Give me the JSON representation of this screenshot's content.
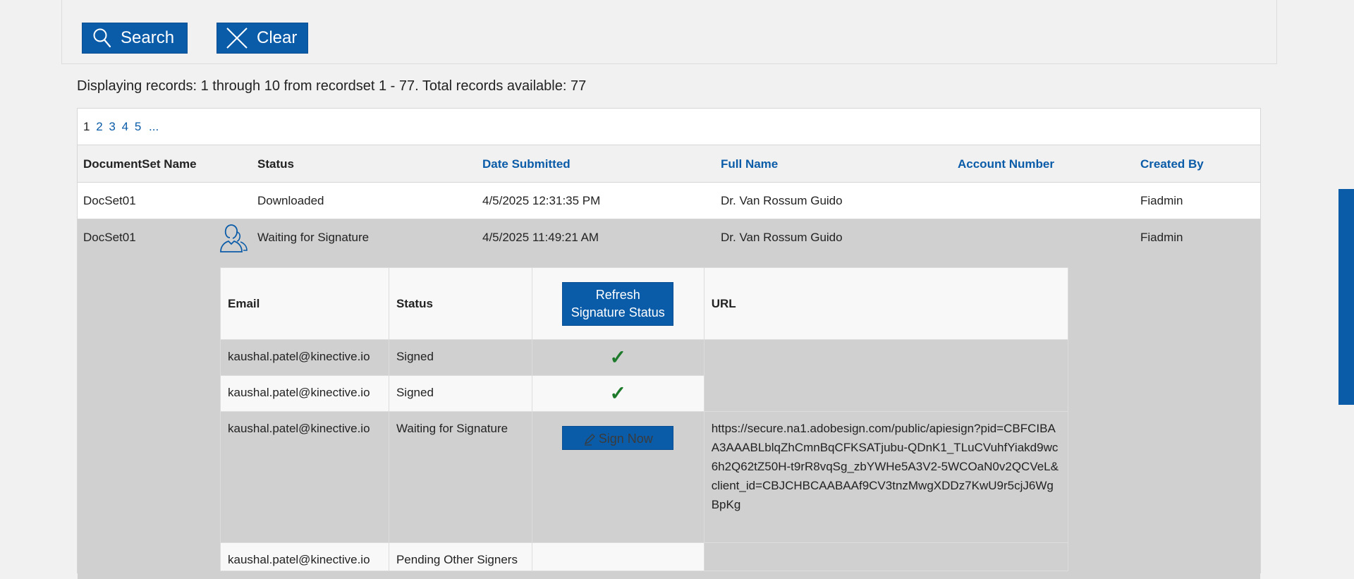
{
  "search": {
    "search_label": "Search",
    "clear_label": "Clear"
  },
  "records_info": "Displaying records: 1 through 10 from recordset 1 - 77. Total records available: 77",
  "pager": {
    "current": "1",
    "pages": [
      "2",
      "3",
      "4",
      "5"
    ],
    "more": "..."
  },
  "columns": {
    "name": "DocumentSet Name",
    "status": "Status",
    "date": "Date Submitted",
    "full_name": "Full Name",
    "account": "Account Number",
    "created_by": "Created By"
  },
  "rows": [
    {
      "name": "DocSet01",
      "status": "Downloaded",
      "date": "4/5/2025 12:31:35 PM",
      "full_name": "Dr. Van Rossum Guido",
      "account": "",
      "created_by": "Fiadmin"
    },
    {
      "name": "DocSet01",
      "status": "Waiting for Signature",
      "date": "4/5/2025 11:49:21 AM",
      "full_name": "Dr. Van Rossum Guido",
      "account": "",
      "created_by": "Fiadmin"
    }
  ],
  "signers": {
    "headers": {
      "email": "Email",
      "status": "Status",
      "refresh_line1": "Refresh",
      "refresh_line2": "Signature Status",
      "url": "URL"
    },
    "rows": [
      {
        "email": "kaushal.patel@kinective.io",
        "status": "Signed",
        "check": "✓"
      },
      {
        "email": "kaushal.patel@kinective.io",
        "status": "Signed",
        "check": "✓"
      },
      {
        "email": "kaushal.patel@kinective.io",
        "status": "Waiting for Signature",
        "action": "Sign Now",
        "url": "https://secure.na1.adobesign.com/public/apiesign?pid=CBFCIBAA3AAABLblqZhCmnBqCFKSATjubu-QDnK1_TLuCVuhfYiakd9wc6h2Q62tZ50H-t9rR8vqSg_zbYWHe5A3V2-5WCOaN0v2QCVeL&client_id=CBJCHBCAABAAf9CV3tnzMwgXDDz7KwU9r5cjJ6WgBpKg"
      },
      {
        "email": "kaushal.patel@kinective.io",
        "status": "Pending Other Signers"
      }
    ]
  },
  "colors": {
    "accent": "#0b5ca8",
    "check": "#1d7a2b",
    "row_highlight": "#d0d0d0"
  }
}
